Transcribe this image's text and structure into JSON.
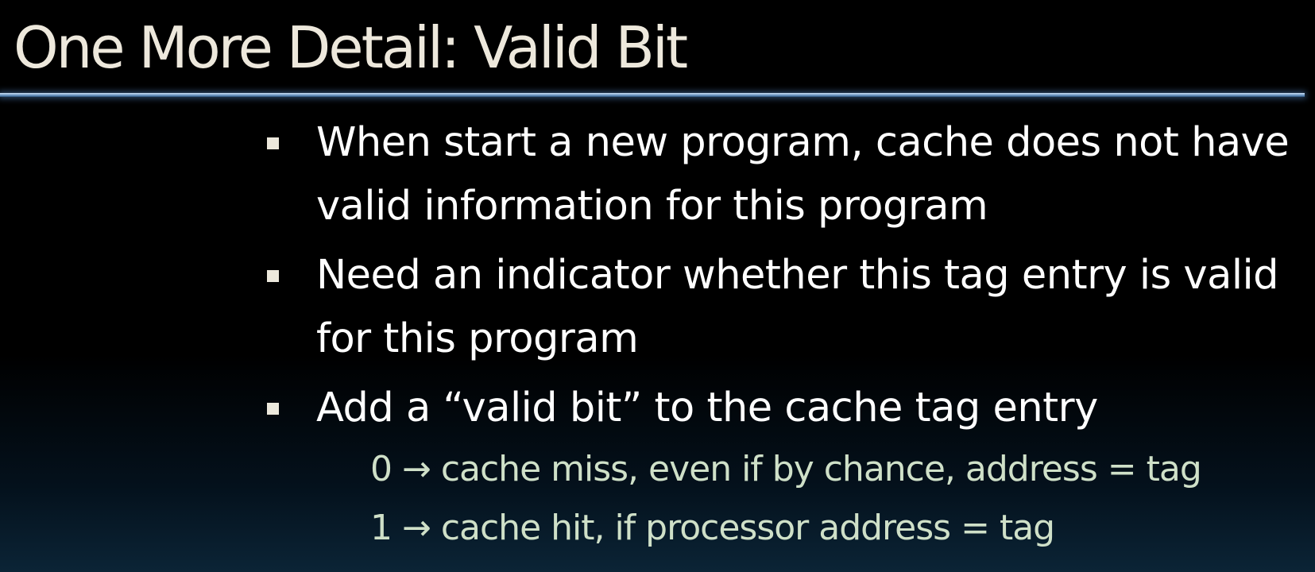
{
  "slide": {
    "title": "One More Detail: Valid Bit",
    "bullets": [
      {
        "text": "When start a new program, cache does not have valid information for this program"
      },
      {
        "text": "Need an indicator whether this tag entry is valid for this program"
      },
      {
        "text": "Add a “valid bit” to the cache tag entry"
      }
    ],
    "sub_items": [
      {
        "text": "0 → cache miss, even if by chance, address = tag"
      },
      {
        "text": "1 → cache hit, if processor address = tag"
      }
    ]
  },
  "colors": {
    "title": "#ede8dc",
    "bullet_text": "#ffffff",
    "sub_text": "#cfe0c8",
    "rule": "#6b95c2",
    "background": "#000000"
  }
}
